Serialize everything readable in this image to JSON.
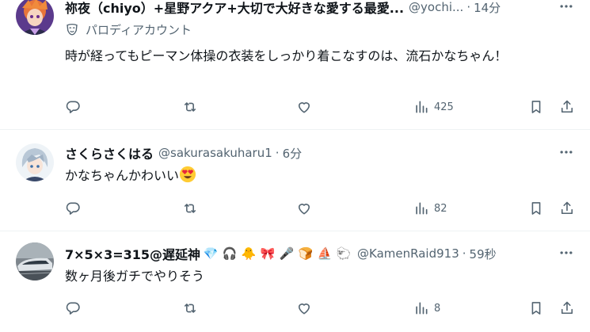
{
  "tweets": [
    {
      "name": "祢夜（chiyo）+星野アクア+大切で大好きな愛する最愛...",
      "handle": "@yochi...",
      "time": "14分",
      "label": "パロディアカウント",
      "text": "時が経ってもピーマン体操の衣装をしっかり着こなすのは、流石かなちゃん！",
      "views": "425"
    },
    {
      "name": "さくらさくはる",
      "handle": "@sakurasakuharu1",
      "time": "6分",
      "text": "かなちゃんかわいい",
      "views": "82"
    },
    {
      "name": "7×5×3=315@遅延神",
      "handle": "@KamenRaid913",
      "time": "59秒",
      "emojis": [
        "💎",
        "🎧",
        "🐥",
        "🎀",
        "🎤",
        "🍞",
        "⛵",
        "🐑"
      ],
      "text": "数ヶ月後ガチでやりそう",
      "views": "8"
    }
  ],
  "dot": "·",
  "icons": [
    "more-icon",
    "parody-mask-icon",
    "reply-icon",
    "repost-icon",
    "like-icon",
    "views-icon",
    "bookmark-icon",
    "share-icon",
    "heart-eyes-emoji"
  ],
  "colors": {
    "text": "#0f1419",
    "secondary": "#536471",
    "divider": "#eff3f4"
  }
}
